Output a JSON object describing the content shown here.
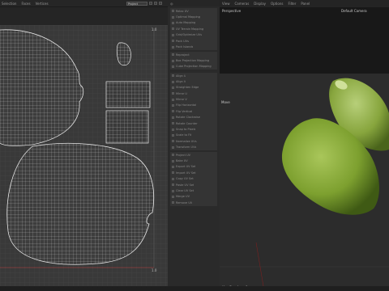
{
  "uv_editor": {
    "menu": [
      "Selection",
      "Faces",
      "Vertices"
    ],
    "selector_value": "Project",
    "axis_ticks": {
      "top_right": "1.0",
      "bottom_right": "1.0"
    }
  },
  "middle_panel": {
    "header": "◎",
    "groups": [
      [
        "Relax UV",
        "Optimal Mapping",
        "Auto Mapping",
        "UV Terrain Mapping",
        "Grid/Optimize UVs",
        "Pack UVs",
        "Pack Islands"
      ],
      [
        "Reproject",
        "Box Projection Mapping",
        "Cube Projection Mapping"
      ],
      [
        "Align U",
        "Align V",
        "Straighten Edge"
      ],
      [
        "Mirror U",
        "Mirror V",
        "Flip Horizontal",
        "Flip Vertical",
        "Rotate Clockwise",
        "Rotate Counter",
        "Snap to Pixels",
        "Scale to Fit",
        "Normalize UVs",
        "Transform UVs"
      ],
      [
        "Project UV",
        "Bake UV",
        "Export UV Set",
        "Import UV Set",
        "Copy UV Set",
        "Paste UV Set",
        "Clear UV Set",
        "Merge UV",
        "Remove UV"
      ]
    ]
  },
  "viewport": {
    "menu": [
      "View",
      "Cameras",
      "Display",
      "Options",
      "Filter",
      "Panel"
    ],
    "projection": "Perspective",
    "camera": "Default Camera",
    "axis_move": "Move",
    "footer": "View Transform: Scene"
  },
  "colors": {
    "seed_green": "#7da02f",
    "uv_bg": "#393939",
    "viewport_bg": "#2c2c2c"
  }
}
